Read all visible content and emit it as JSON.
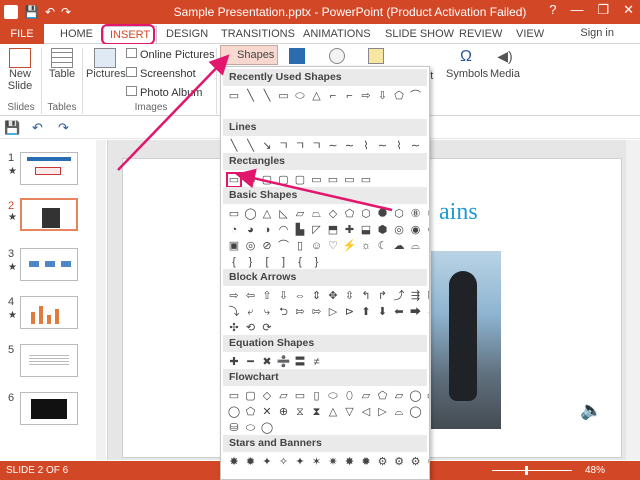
{
  "titlebar": {
    "title": "Sample Presentation.pptx - PowerPoint (Product Activation Failed)",
    "help": "?",
    "min": "—",
    "restore": "❐",
    "close": "✕"
  },
  "qat": {
    "save": "💾",
    "undo": "↶",
    "redo": "↷"
  },
  "tabs": [
    "HOME",
    "INSERT",
    "DESIGN",
    "TRANSITIONS",
    "ANIMATIONS",
    "SLIDE SHOW",
    "REVIEW",
    "VIEW"
  ],
  "file_tab": "FILE",
  "signin": "Sign in",
  "ribbon": {
    "new_slide": "New",
    "new_slide2": "Slide",
    "table": "Table",
    "pictures": "Pictures",
    "online_pictures": "Online Pictures",
    "screenshot": "Screenshot",
    "photo_album": "Photo Album",
    "shapes": "Shapes",
    "symbols": "Symbols",
    "media": "Media",
    "text_fragment": "xt",
    "groups": {
      "slides": "Slides",
      "tables": "Tables",
      "images": "Images"
    }
  },
  "slides": {
    "numbers": [
      "1",
      "2",
      "3",
      "4",
      "5",
      "6"
    ],
    "stars": [
      "★",
      "★",
      "★",
      "★"
    ]
  },
  "slide": {
    "title_fragment": "ains"
  },
  "status": {
    "text": "SLIDE 2 OF 6",
    "zoom": "48%"
  },
  "dropdown": {
    "sections": [
      "Recently Used Shapes",
      "Lines",
      "Rectangles",
      "Basic Shapes",
      "Block Arrows",
      "Equation Shapes",
      "Flowchart",
      "Stars and Banners"
    ],
    "rows": {
      "recent": [
        "▭",
        "╲",
        "╲",
        "▭",
        "⬭",
        "△",
        "⌐",
        "⌐",
        "⇨",
        "⇩",
        "⬠",
        "⌒",
        "{",
        "}",
        "☆"
      ],
      "lines": [
        "╲",
        "╲",
        "↘",
        "ㄱ",
        "ㄱ",
        "ㄱ",
        "∼",
        "∼",
        "⌇",
        "∼",
        "⌇",
        "∼"
      ],
      "rects": [
        "▭",
        "▭",
        "▢",
        "▢",
        "▢",
        "▭",
        "▭",
        "▭",
        "▭"
      ],
      "basic1": [
        "▭",
        "◯",
        "△",
        "◺",
        "▱",
        "⏢",
        "◇",
        "⬠",
        "⬡",
        "⯃",
        "⬡",
        "⑧",
        "⑩",
        "⑫"
      ],
      "basic2": [
        "◔",
        "◕",
        "◑",
        "◠",
        "▙",
        "◸",
        "⬒",
        "✚",
        "⬓",
        "⬢",
        "◎",
        "◉",
        "⊘",
        "⊙"
      ],
      "basic3": [
        "▣",
        "◎",
        "⊘",
        "⌒",
        "▯",
        "☺",
        "♡",
        "⚡",
        "☼",
        "☾",
        "☁",
        "⌓"
      ],
      "basic4": [
        "{",
        "}",
        "[",
        "]",
        "{",
        "}"
      ],
      "arrows1": [
        "⇨",
        "⇦",
        "⇧",
        "⇩",
        "⇔",
        "⇕",
        "✥",
        "⇳",
        "↰",
        "↱",
        "⤴",
        "⇶",
        "⇱",
        "⇲"
      ],
      "arrows2": [
        "⤵",
        "⤶",
        "⤷",
        "⮌",
        "⇰",
        "⇰",
        "▷",
        "⊳",
        "⬆",
        "⬇",
        "⬅",
        "⮕",
        "⇔",
        "⇕"
      ],
      "arrows3": [
        "✣",
        "⟲",
        "⟳"
      ],
      "equation": [
        "✚",
        "━",
        "✖",
        "➗",
        "〓",
        "≠"
      ],
      "flow1": [
        "▭",
        "▢",
        "◇",
        "▱",
        "▭",
        "▯",
        "⬭",
        "⬯",
        "⏥",
        "⬠",
        "▱",
        "◯",
        "▭",
        "⌂"
      ],
      "flow2": [
        "◯",
        "⬠",
        "✕",
        "⊕",
        "⧖",
        "⧗",
        "△",
        "▽",
        "◁",
        "▷",
        "⌓",
        "◯",
        "⌸",
        "⬠"
      ],
      "flow3": [
        "⛁",
        "⬭",
        "◯"
      ],
      "stars": [
        "✸",
        "✹",
        "✦",
        "✧",
        "✦",
        "✶",
        "✷",
        "✸",
        "✹",
        "⚙",
        "⚙",
        "⚙",
        "⚙",
        "⚙"
      ]
    }
  }
}
